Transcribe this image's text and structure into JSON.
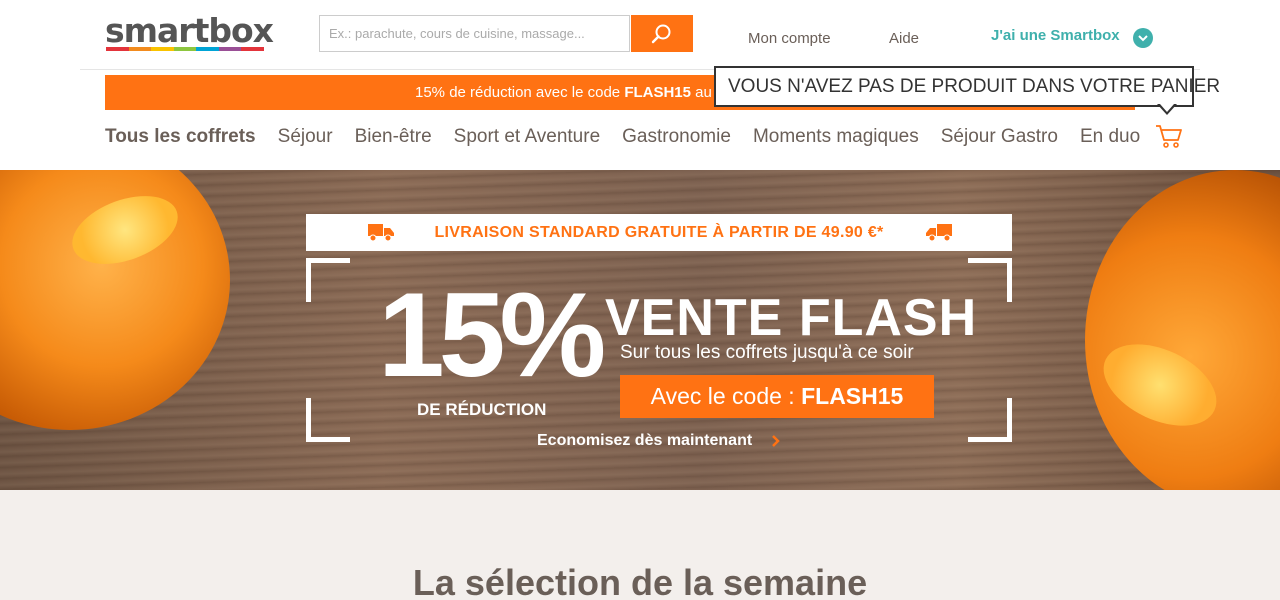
{
  "header": {
    "logo_text": "smartbox",
    "logo_colors": [
      "#e3343b",
      "#f28b1e",
      "#f9c300",
      "#8dc63f",
      "#00a4d6",
      "#9a4f96",
      "#e3343b"
    ],
    "search_placeholder": "Ex.: parachute, cours de cuisine, massage...",
    "search_icon": "search-icon",
    "account_label": "Mon compte",
    "help_label": "Aide",
    "smartbox_label": "J'ai une Smartbox",
    "smartbox_icon": "chevron-down-icon",
    "accent_color": "#ff7213",
    "teal_color": "#3fb0ac"
  },
  "promo": {
    "text_before": "15% de réduction avec le code ",
    "code": "FLASH15",
    "text_after": " au"
  },
  "cart": {
    "tooltip": "VOUS N'AVEZ PAS DE PRODUIT DANS VOTRE PANIER",
    "icon": "cart-icon"
  },
  "nav": {
    "items": [
      {
        "label": "Tous les coffrets",
        "active": true
      },
      {
        "label": "Séjour",
        "active": false
      },
      {
        "label": "Bien-être",
        "active": false
      },
      {
        "label": "Sport et Aventure",
        "active": false
      },
      {
        "label": "Gastronomie",
        "active": false
      },
      {
        "label": "Moments magiques",
        "active": false
      },
      {
        "label": "Séjour Gastro",
        "active": false
      },
      {
        "label": "En duo",
        "active": false
      }
    ]
  },
  "hero": {
    "delivery_text": "LIVRAISON STANDARD GRATUITE À PARTIR DE 49.90 €*",
    "truck_icon": "truck-icon",
    "big_percent": "15%",
    "reduction_label": "DE RÉDUCTION",
    "flash_title": "VENTE FLASH",
    "flash_subtitle": "Sur tous les coffrets jusqu'à ce soir",
    "code_prefix": "Avec le code : ",
    "code": "FLASH15",
    "cta_label": "Economisez dès maintenant",
    "cta_icon": "chevron-right-icon"
  },
  "selection": {
    "title": "La sélection de la semaine"
  }
}
